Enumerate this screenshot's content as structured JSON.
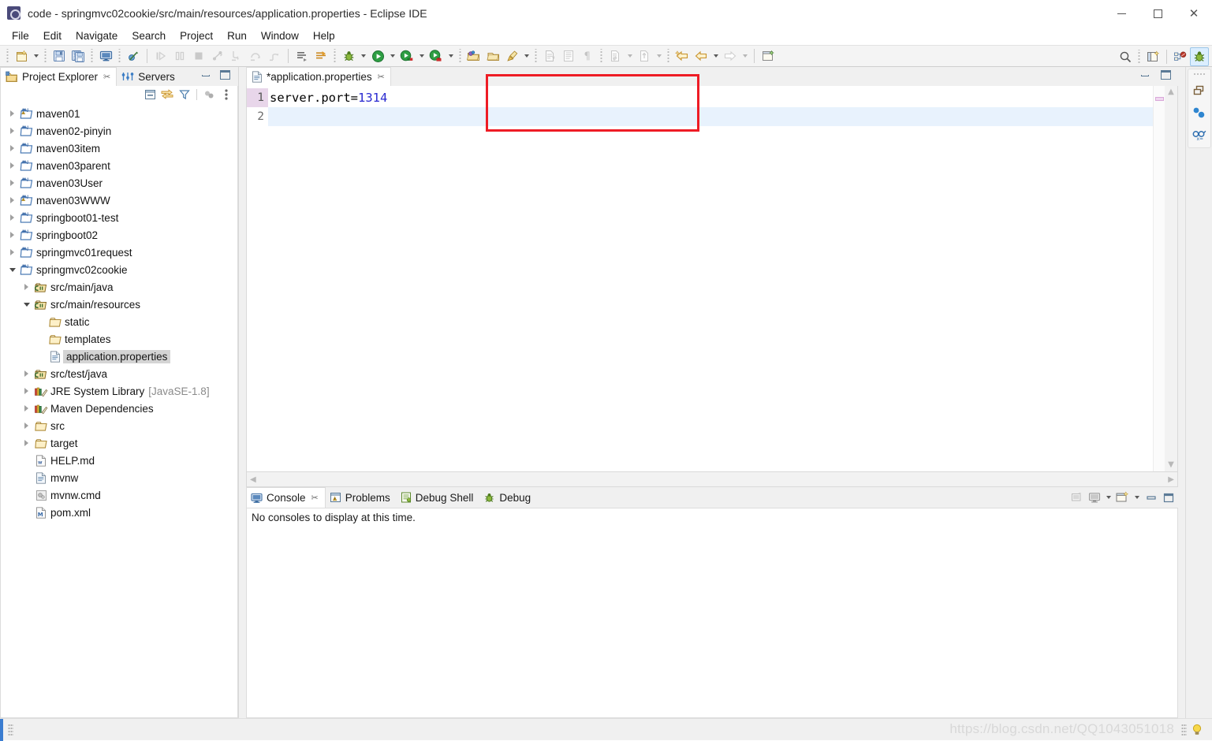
{
  "window": {
    "title": "code - springmvc02cookie/src/main/resources/application.properties - Eclipse IDE",
    "app_icon": "eclipse-icon",
    "minimize_label": "Minimize",
    "maximize_label": "Maximize",
    "close_label": "Close"
  },
  "menubar": {
    "items": [
      {
        "label": "File"
      },
      {
        "label": "Edit"
      },
      {
        "label": "Navigate"
      },
      {
        "label": "Search"
      },
      {
        "label": "Project"
      },
      {
        "label": "Run"
      },
      {
        "label": "Window"
      },
      {
        "label": "Help"
      }
    ]
  },
  "toolbar": {
    "groups": [
      {
        "buttons": [
          {
            "name": "new-wizard-button",
            "icon": "new-file-icon",
            "enabled": true,
            "dropdown": true
          },
          {
            "name": "save-button",
            "icon": "save-icon",
            "enabled": true
          },
          {
            "name": "save-all-button",
            "icon": "save-all-icon",
            "enabled": true
          },
          {
            "name": "open-console-button",
            "icon": "console-icon",
            "enabled": true
          },
          {
            "name": "skip-breakpoints-button",
            "icon": "skip-breakpoints-icon",
            "enabled": true
          }
        ]
      },
      {
        "buttons": [
          {
            "name": "resume-button",
            "icon": "resume-icon",
            "enabled": false
          },
          {
            "name": "suspend-button",
            "icon": "suspend-icon",
            "enabled": false
          },
          {
            "name": "terminate-button",
            "icon": "terminate-icon",
            "enabled": false
          },
          {
            "name": "disconnect-button",
            "icon": "disconnect-icon",
            "enabled": false
          },
          {
            "name": "step-into-button",
            "icon": "step-into-icon",
            "enabled": false
          },
          {
            "name": "step-over-button",
            "icon": "step-over-icon",
            "enabled": false
          },
          {
            "name": "step-return-button",
            "icon": "step-return-icon",
            "enabled": false
          }
        ]
      },
      {
        "buttons": [
          {
            "name": "next-annotation-button",
            "icon": "next-annotation-icon",
            "enabled": true
          },
          {
            "name": "previous-annotation-button",
            "icon": "previous-annotation-icon",
            "enabled": true
          }
        ]
      },
      {
        "buttons": [
          {
            "name": "debug-button",
            "icon": "debug-bug-icon",
            "enabled": true,
            "dropdown": true
          },
          {
            "name": "run-button",
            "icon": "run-play-icon",
            "enabled": true,
            "dropdown": true
          },
          {
            "name": "run-as-server-button",
            "icon": "run-server-icon",
            "enabled": true,
            "dropdown": true
          },
          {
            "name": "coverage-button",
            "icon": "coverage-icon",
            "enabled": true,
            "dropdown": true
          }
        ]
      },
      {
        "buttons": [
          {
            "name": "new-java-package-button",
            "icon": "new-package-icon",
            "enabled": true
          },
          {
            "name": "new-java-class-button",
            "icon": "new-class-icon",
            "enabled": true
          },
          {
            "name": "external-tools-button",
            "icon": "external-tools-icon",
            "enabled": true,
            "dropdown": true
          }
        ]
      },
      {
        "buttons": [
          {
            "name": "new-untitled-text-file-button",
            "icon": "untitled-text-icon",
            "enabled": false
          },
          {
            "name": "toggle-block-selection-button",
            "icon": "block-selection-icon",
            "enabled": false
          },
          {
            "name": "show-whitespace-button",
            "icon": "pilcrow-icon",
            "enabled": false
          }
        ]
      },
      {
        "buttons": [
          {
            "name": "last-edit-location-button",
            "icon": "last-edit-icon",
            "enabled": false,
            "dropdown": true
          },
          {
            "name": "open-type-button",
            "icon": "open-type-icon",
            "enabled": false,
            "dropdown": true
          }
        ]
      },
      {
        "buttons": [
          {
            "name": "back-to-button",
            "icon": "back-arrow-star-icon",
            "enabled": true
          },
          {
            "name": "previous-edit-button",
            "icon": "back-arrow-icon",
            "enabled": true,
            "dropdown": true
          },
          {
            "name": "forward-button",
            "icon": "forward-arrow-icon",
            "enabled": false,
            "dropdown": true
          }
        ]
      },
      {
        "buttons": [
          {
            "name": "new-editor-button",
            "icon": "new-editor-icon",
            "enabled": true
          }
        ]
      }
    ],
    "right_buttons": [
      {
        "name": "quick-access-search-button",
        "icon": "search-icon"
      },
      {
        "name": "open-perspective-button",
        "icon": "open-perspective-icon"
      },
      {
        "name": "perspective-java-ee-button",
        "icon": "java-ee-perspective-icon"
      },
      {
        "name": "perspective-debug-button",
        "icon": "debug-perspective-icon",
        "active": true
      }
    ]
  },
  "project_explorer": {
    "tabs": [
      {
        "label": "Project Explorer",
        "icon": "project-explorer-icon",
        "selected": true,
        "closable": true
      },
      {
        "label": "Servers",
        "icon": "servers-icon",
        "selected": false,
        "closable": false
      }
    ],
    "view_buttons": [
      {
        "name": "collapse-all-button",
        "icon": "collapse-all-icon"
      },
      {
        "name": "link-with-editor-button",
        "icon": "link-editor-icon"
      },
      {
        "name": "view-filters-button",
        "icon": "filter-icon"
      },
      {
        "name": "working-sets-button",
        "icon": "working-sets-icon"
      },
      {
        "name": "view-menu-button",
        "icon": "view-menu-icon"
      }
    ],
    "tree": [
      {
        "label": "maven01",
        "icon": "maven-project-icon",
        "indent": 0,
        "twisty": "right",
        "warning": true
      },
      {
        "label": "maven02-pinyin",
        "icon": "maven-project-icon",
        "indent": 0,
        "twisty": "right"
      },
      {
        "label": "maven03item",
        "icon": "maven-project-icon",
        "indent": 0,
        "twisty": "right"
      },
      {
        "label": "maven03parent",
        "icon": "maven-project-icon",
        "indent": 0,
        "twisty": "right"
      },
      {
        "label": "maven03User",
        "icon": "maven-project-icon",
        "indent": 0,
        "twisty": "right"
      },
      {
        "label": "maven03WWW",
        "icon": "maven-project-icon",
        "indent": 0,
        "twisty": "right",
        "warning": true
      },
      {
        "label": "springboot01-test",
        "icon": "maven-project-icon",
        "indent": 0,
        "twisty": "right"
      },
      {
        "label": "springboot02",
        "icon": "maven-project-icon",
        "indent": 0,
        "twisty": "right"
      },
      {
        "label": "springmvc01request",
        "icon": "maven-project-icon",
        "indent": 0,
        "twisty": "right"
      },
      {
        "label": "springmvc02cookie",
        "icon": "maven-project-icon",
        "indent": 0,
        "twisty": "down"
      },
      {
        "label": "src/main/java",
        "icon": "source-folder-icon",
        "indent": 1,
        "twisty": "right"
      },
      {
        "label": "src/main/resources",
        "icon": "source-folder-icon",
        "indent": 1,
        "twisty": "down"
      },
      {
        "label": "static",
        "icon": "folder-icon",
        "indent": 2,
        "twisty": "none"
      },
      {
        "label": "templates",
        "icon": "folder-icon",
        "indent": 2,
        "twisty": "none"
      },
      {
        "label": "application.properties",
        "icon": "properties-file-icon",
        "indent": 2,
        "twisty": "none",
        "selected": true
      },
      {
        "label": "src/test/java",
        "icon": "source-folder-icon",
        "indent": 1,
        "twisty": "right"
      },
      {
        "label": "JRE System Library",
        "sublabel": "[JavaSE-1.8]",
        "icon": "library-icon",
        "indent": 1,
        "twisty": "right"
      },
      {
        "label": "Maven Dependencies",
        "icon": "library-icon",
        "indent": 1,
        "twisty": "right"
      },
      {
        "label": "src",
        "icon": "folder-icon",
        "indent": 1,
        "twisty": "right"
      },
      {
        "label": "target",
        "icon": "folder-icon",
        "indent": 1,
        "twisty": "right"
      },
      {
        "label": "HELP.md",
        "icon": "markdown-file-icon",
        "indent": 1,
        "twisty": "none"
      },
      {
        "label": "mvnw",
        "icon": "text-file-icon",
        "indent": 1,
        "twisty": "none"
      },
      {
        "label": "mvnw.cmd",
        "icon": "cmd-file-icon",
        "indent": 1,
        "twisty": "none"
      },
      {
        "label": "pom.xml",
        "icon": "pom-file-icon",
        "indent": 1,
        "twisty": "none"
      }
    ]
  },
  "editor": {
    "tab": {
      "label": "*application.properties",
      "icon": "properties-file-icon",
      "dirty": true,
      "closable": true
    },
    "minimize_label": "Minimize",
    "maximize_label": "Maximize",
    "lines": [
      {
        "number": "1",
        "current": true,
        "segments": [
          {
            "text": "server.port=",
            "kind": "plain"
          },
          {
            "text": "1314",
            "kind": "number"
          }
        ]
      },
      {
        "number": "2",
        "current": false,
        "highlighted": true,
        "segments": [
          {
            "text": "",
            "kind": "plain"
          }
        ]
      }
    ],
    "annotation_box": {
      "color": "#ee1c25",
      "label": "highlight-box"
    }
  },
  "console_panel": {
    "tabs": [
      {
        "label": "Console",
        "icon": "console-icon",
        "selected": true,
        "closable": true
      },
      {
        "label": "Problems",
        "icon": "problems-icon",
        "selected": false
      },
      {
        "label": "Debug Shell",
        "icon": "debug-shell-icon",
        "selected": false
      },
      {
        "label": "Debug",
        "icon": "debug-bug-icon",
        "selected": false
      }
    ],
    "tools": [
      {
        "name": "terminate-console-button",
        "icon": "terminate-icon"
      },
      {
        "name": "display-selected-console-button",
        "icon": "console-icon",
        "dropdown": true
      },
      {
        "name": "open-console-button",
        "icon": "new-console-icon",
        "dropdown": true
      },
      {
        "name": "minimize-button",
        "icon": "minimize-icon"
      },
      {
        "name": "maximize-button",
        "icon": "maximize-icon"
      }
    ],
    "message": "No consoles to display at this time."
  },
  "fastview": {
    "buttons": [
      {
        "name": "restore-button",
        "icon": "restore-icon"
      },
      {
        "name": "breakpoints-view-button",
        "icon": "breakpoints-icon"
      },
      {
        "name": "variables-view-button",
        "icon": "variables-icon"
      }
    ]
  },
  "statusbar": {
    "watermark": "https://blog.csdn.net/QQ1043051018",
    "bulb_icon": "tip-bulb-icon"
  },
  "colors": {
    "accent": "#3a7cd0",
    "annotation_red": "#ee1c25",
    "number_literal": "#2a2ad0",
    "current_line_gutter": "#e8d6ea",
    "current_line_bg": "#e8f2fd"
  }
}
